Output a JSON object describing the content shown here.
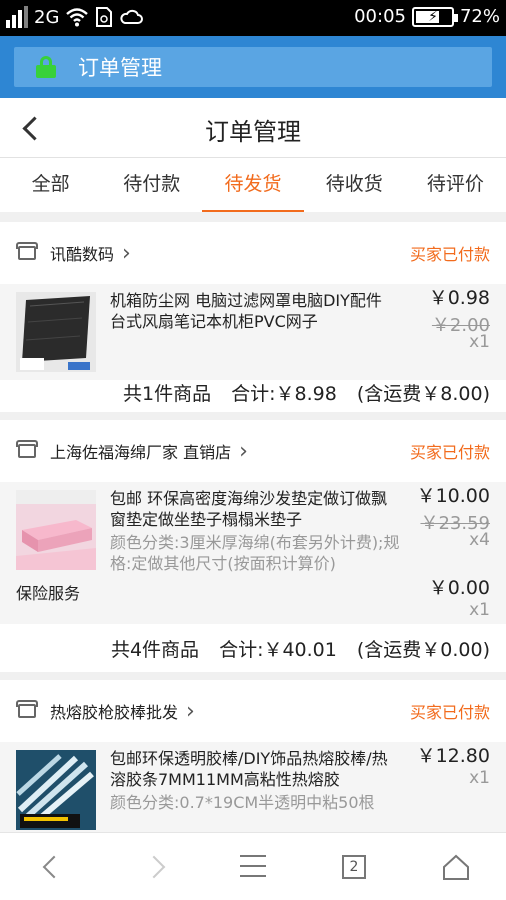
{
  "statusbar": {
    "network": "2G",
    "time": "00:05",
    "battery": "72%",
    "battery_level": 0.72
  },
  "browser": {
    "title": "订单管理"
  },
  "header": {
    "title": "订单管理"
  },
  "tabs": [
    {
      "label": "全部"
    },
    {
      "label": "待付款"
    },
    {
      "label": "待发货",
      "active": true
    },
    {
      "label": "待收货"
    },
    {
      "label": "待评价"
    }
  ],
  "orders": [
    {
      "shop": "讯酷数码",
      "status": "买家已付款",
      "item": {
        "title": "机箱防尘网 电脑过滤网罩电脑DIY配件 台式风扇笔记本机柜PVC网子",
        "price": "￥0.98",
        "original_price": "￥2.00",
        "qty": "x1"
      },
      "summary": {
        "count": "共1件商品",
        "total": "合计:￥8.98",
        "shipping": "(含运费￥8.00)"
      }
    },
    {
      "shop": "上海佐福海绵厂家 直销店",
      "status": "买家已付款",
      "item": {
        "title": "包邮 环保高密度海绵沙发垫定做订做飘窗垫定做坐垫子榻榻米垫子",
        "spec": "颜色分类:3厘米厚海绵(布套另外计费);规格:定做其他尺寸(按面积计算价)",
        "price": "￥10.00",
        "original_price": "￥23.59",
        "qty": "x4"
      },
      "service": {
        "label": "保险服务",
        "price": "￥0.00",
        "qty": "x1"
      },
      "summary": {
        "count": "共4件商品",
        "total": "合计:￥40.01",
        "shipping": "(含运费￥0.00)"
      }
    },
    {
      "shop": "热熔胶枪胶棒批发",
      "status": "买家已付款",
      "item": {
        "title": "包邮环保透明胶棒/DIY饰品热熔胶棒/热溶胶条7MM11MM高粘性热熔胶",
        "spec": "颜色分类:0.7*19CM半透明中粘50根",
        "price": "￥12.80",
        "qty": "x1"
      }
    }
  ],
  "navbar": {
    "tab_count": "2"
  }
}
